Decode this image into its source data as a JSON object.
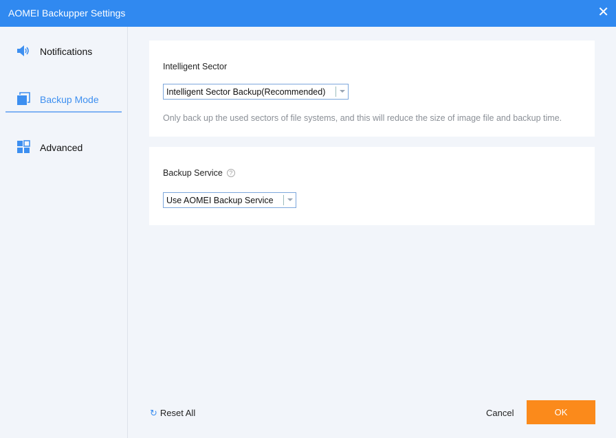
{
  "window": {
    "title": "AOMEI Backupper Settings",
    "close": "✕"
  },
  "sidebar": {
    "items": [
      {
        "label": "Notifications",
        "icon": "speaker-icon"
      },
      {
        "label": "Backup Mode",
        "icon": "copy-icon",
        "active": true
      },
      {
        "label": "Advanced",
        "icon": "grid-icon"
      }
    ]
  },
  "intelligent": {
    "title": "Intelligent Sector",
    "value": "Intelligent Sector Backup(Recommended)",
    "description": "Only back up the used sectors of file systems, and this will reduce the size of image file and backup time."
  },
  "service": {
    "title": "Backup Service",
    "help": "?",
    "value": "Use AOMEI Backup Service"
  },
  "footer": {
    "reset": "Reset All",
    "reset_icon": "↻",
    "cancel": "Cancel",
    "ok": "OK"
  },
  "colors": {
    "accent": "#3089f0",
    "ok": "#fb8a1b"
  }
}
